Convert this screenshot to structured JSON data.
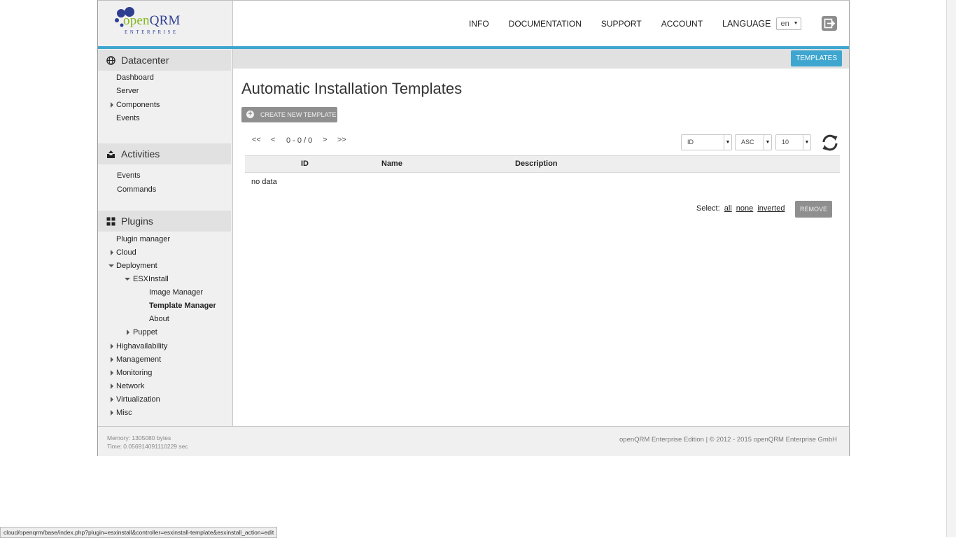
{
  "brand": {
    "name_open": "open",
    "name_qrm": "QRM",
    "tagline": "ENTERPRISE"
  },
  "top_nav": {
    "links": [
      "INFO",
      "DOCUMENTATION",
      "SUPPORT",
      "ACCOUNT"
    ],
    "language_label": "LANGUAGE",
    "language_value": "en"
  },
  "sub_bar": {
    "tab_label": "TEMPLATES"
  },
  "sidebar": {
    "datacenter": {
      "title": "Datacenter",
      "items": [
        "Dashboard",
        "Server",
        "Components",
        "Events"
      ]
    },
    "activities": {
      "title": "Activities",
      "items": [
        "Events",
        "Commands"
      ]
    },
    "plugins": {
      "title": "Plugins",
      "items": [
        "Plugin manager",
        "Cloud",
        "Deployment",
        "ESXInstall",
        "Image Manager",
        "Template Manager",
        "About",
        "Puppet",
        "Highavailability",
        "Management",
        "Monitoring",
        "Network",
        "Virtualization",
        "Misc"
      ]
    }
  },
  "main": {
    "title": "Automatic Installation Templates",
    "create_label": "CREATE NEW TEMPLATE",
    "pager": {
      "first": "<<",
      "prev": "<",
      "range": "0 - 0 / 0",
      "next": ">",
      "last": ">>"
    },
    "sort": {
      "field": "ID",
      "order": "ASC",
      "limit": "10"
    },
    "table": {
      "columns": [
        "ID",
        "Name",
        "Description"
      ],
      "empty_text": "no data"
    },
    "select": {
      "label": "Select:",
      "all": "all",
      "none": "none",
      "inverted": "inverted"
    },
    "remove_label": "REMOVE"
  },
  "footer": {
    "memory": "Memory: 1305080 bytes",
    "time": "Time: 0.056914091110229 sec",
    "copyright": "openQRM Enterprise Edition | © 2012 - 2015 openQRM Enterprise GmbH"
  },
  "status_url": "cloud/openqrm/base/index.php?plugin=esxinstall&controller=esxinstall-template&esxinstall_action=edit",
  "colors": {
    "accent": "#3ea6cf",
    "brand_green": "#84b819",
    "brand_blue": "#2e3f92",
    "button_gray": "#8f8f8f"
  }
}
